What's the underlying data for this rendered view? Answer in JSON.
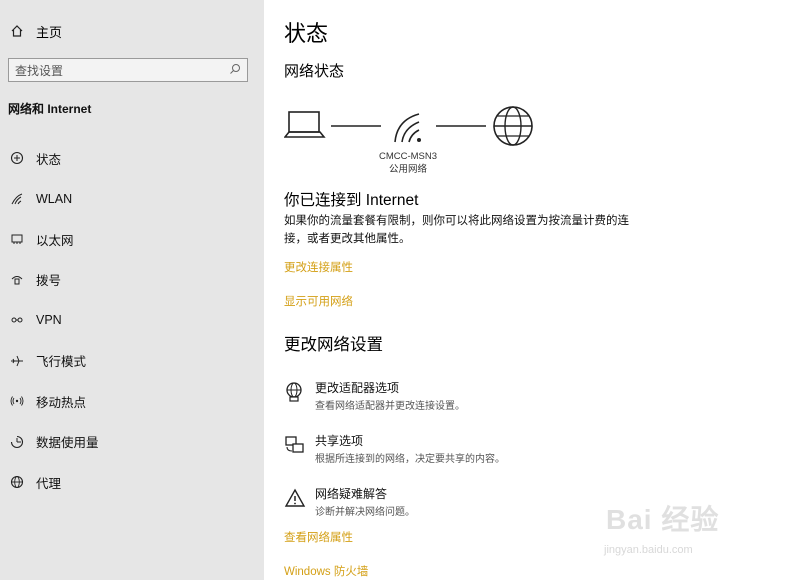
{
  "sidebar": {
    "home_label": "主页",
    "search_placeholder": "查找设置",
    "section_title": "网络和 Internet",
    "items": [
      {
        "label": "状态",
        "icon": "status-icon"
      },
      {
        "label": "WLAN",
        "icon": "wlan-icon"
      },
      {
        "label": "以太网",
        "icon": "ethernet-icon"
      },
      {
        "label": "拨号",
        "icon": "dialup-icon"
      },
      {
        "label": "VPN",
        "icon": "vpn-icon"
      },
      {
        "label": "飞行模式",
        "icon": "airplane-icon"
      },
      {
        "label": "移动热点",
        "icon": "hotspot-icon"
      },
      {
        "label": "数据使用量",
        "icon": "data-usage-icon"
      },
      {
        "label": "代理",
        "icon": "globe-icon"
      }
    ]
  },
  "main": {
    "title": "状态",
    "network_status": "网络状态",
    "network_name": "CMCC-MSN3",
    "network_type": "公用网络",
    "connected_text": "你已连接到 Internet",
    "description": "如果你的流量套餐有限制，则你可以将此网络设置为按流量计费的连接，或者更改其他属性。",
    "link_change_props": "更改连接属性",
    "link_show_networks": "显示可用网络",
    "change_settings_title": "更改网络设置",
    "options": [
      {
        "title": "更改适配器选项",
        "desc": "查看网络适配器并更改连接设置。",
        "icon": "adapter-icon"
      },
      {
        "title": "共享选项",
        "desc": "根据所连接到的网络，决定要共享的内容。",
        "icon": "sharing-icon"
      },
      {
        "title": "网络疑难解答",
        "desc": "诊断并解决网络问题。",
        "icon": "warning-icon"
      }
    ],
    "link_view_props": "查看网络属性",
    "link_firewall": "Windows 防火墙"
  },
  "watermark": {
    "text": "Bai 经验",
    "url": "jingyan.baidu.com"
  },
  "colors": {
    "sidebar_bg": "#e6e6e6",
    "link": "#d4a017"
  }
}
